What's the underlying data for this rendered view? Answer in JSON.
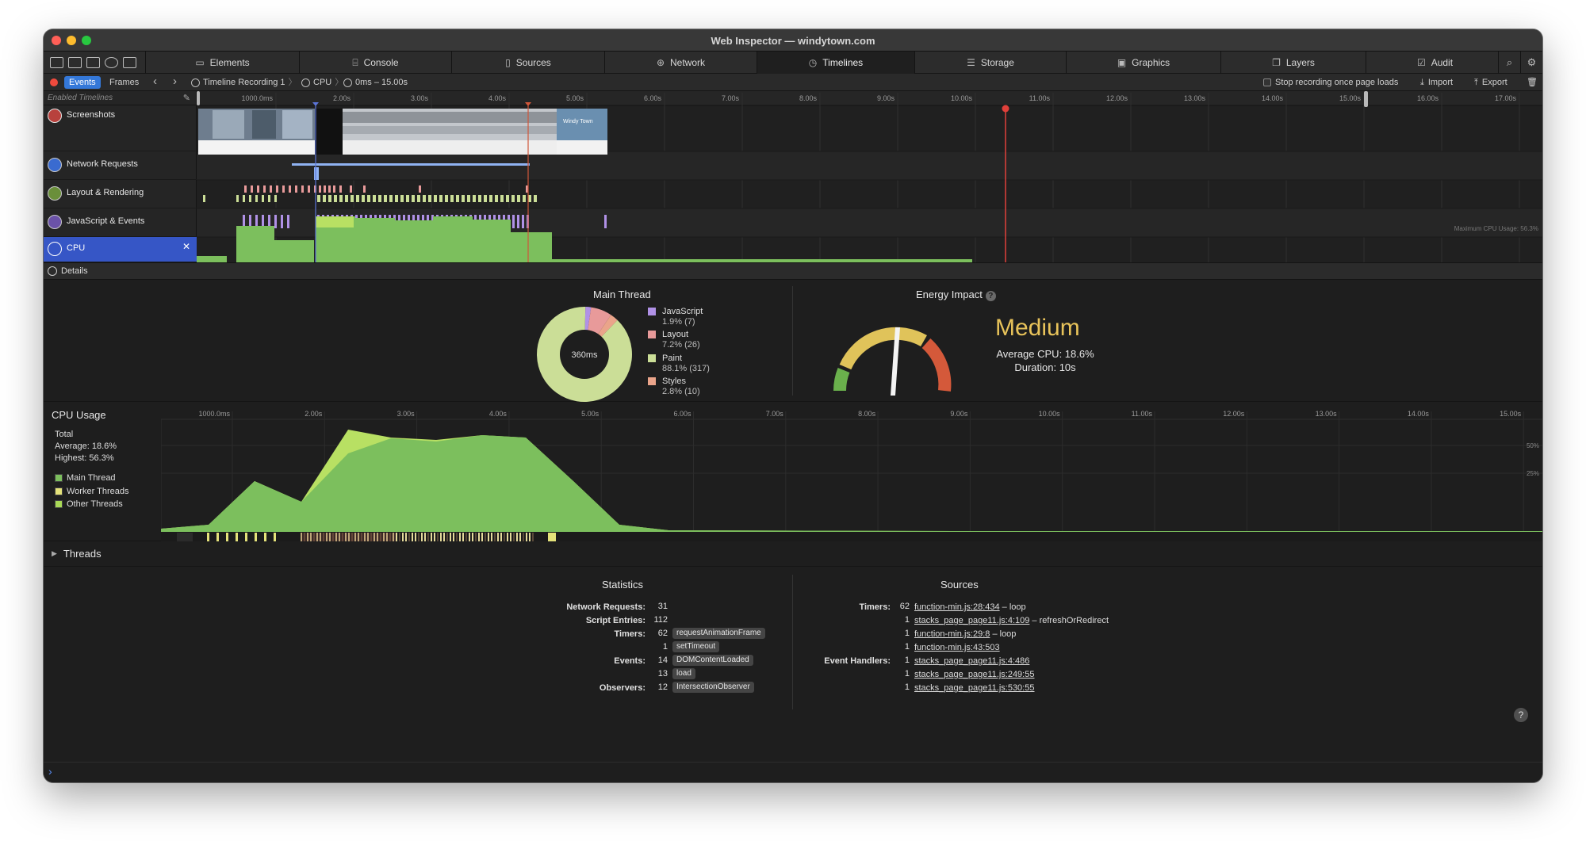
{
  "window": {
    "title": "Web Inspector — windytown.com"
  },
  "tabs": [
    {
      "label": "Elements",
      "icon": "elements-icon"
    },
    {
      "label": "Console",
      "icon": "console-icon"
    },
    {
      "label": "Sources",
      "icon": "sources-icon"
    },
    {
      "label": "Network",
      "icon": "network-icon"
    },
    {
      "label": "Timelines",
      "icon": "timelines-icon"
    },
    {
      "label": "Storage",
      "icon": "storage-icon"
    },
    {
      "label": "Graphics",
      "icon": "graphics-icon"
    },
    {
      "label": "Layers",
      "icon": "layers-icon"
    },
    {
      "label": "Audit",
      "icon": "audit-icon"
    }
  ],
  "toolbar": {
    "events_label": "Events",
    "frames_label": "Frames",
    "recording_name": "Timeline Recording 1",
    "crumb_cpu": "CPU",
    "time_range": "0ms – 15.00s",
    "stop_recording_label": "Stop recording once page loads",
    "import_label": "Import",
    "export_label": "Export"
  },
  "overview": {
    "header": "Enabled Timelines",
    "rows": [
      {
        "label": "Screenshots",
        "icon": "camera-icon"
      },
      {
        "label": "Network Requests",
        "icon": "network-arrows-icon"
      },
      {
        "label": "Layout & Rendering",
        "icon": "brush-icon"
      },
      {
        "label": "JavaScript & Events",
        "icon": "javascript-icon"
      },
      {
        "label": "CPU",
        "icon": "cpu-icon"
      }
    ],
    "ruler_ticks": [
      "1000.0ms",
      "2.00s",
      "3.00s",
      "4.00s",
      "5.00s",
      "6.00s",
      "7.00s",
      "8.00s",
      "9.00s",
      "10.00s",
      "11.00s",
      "12.00s",
      "13.00s",
      "14.00s",
      "15.00s",
      "16.00s",
      "17.00s"
    ],
    "max_cpu_label": "Maximum CPU Usage: 56.3%",
    "screenshot_caption": "Windy Town"
  },
  "details_label": "Details",
  "main_thread": {
    "title": "Main Thread",
    "total": "360ms",
    "legend": [
      {
        "name": "JavaScript",
        "value": "1.9% (7)",
        "color": "#b091e6",
        "pct": 1.9
      },
      {
        "name": "Layout",
        "value": "7.2% (26)",
        "color": "#e89a9a",
        "pct": 7.2
      },
      {
        "name": "Paint",
        "value": "88.1% (317)",
        "color": "#cbde97",
        "pct": 88.1
      },
      {
        "name": "Styles",
        "value": "2.8% (10)",
        "color": "#eaa48a",
        "pct": 2.8
      }
    ]
  },
  "energy": {
    "title": "Energy Impact",
    "level": "Medium",
    "average": "Average CPU: 18.6%",
    "duration": "Duration: 10s",
    "needle_fraction": 0.5
  },
  "cpu_usage": {
    "title": "CPU Usage",
    "total_label": "Total",
    "average": "Average: 18.6%",
    "highest": "Highest: 56.3%",
    "legend": [
      {
        "name": "Main Thread",
        "color": "#7cbf5d"
      },
      {
        "name": "Worker Threads",
        "color": "#e4e27a"
      },
      {
        "name": "Other Threads",
        "color": "#a9d957"
      }
    ],
    "ruler_ticks": [
      "1000.0ms",
      "2.00s",
      "3.00s",
      "4.00s",
      "5.00s",
      "6.00s",
      "7.00s",
      "8.00s",
      "9.00s",
      "10.00s",
      "11.00s",
      "12.00s",
      "13.00s",
      "14.00s",
      "15.00s"
    ],
    "y_label_50": "50%",
    "y_label_25": "25%"
  },
  "threads_label": "Threads",
  "statistics": {
    "title": "Statistics",
    "rows": [
      {
        "key": "Network Requests:",
        "count": "31",
        "pill": ""
      },
      {
        "key": "Script Entries:",
        "count": "112",
        "pill": ""
      },
      {
        "key": "Timers:",
        "count": "62",
        "pill": "requestAnimationFrame"
      },
      {
        "key": "",
        "count": "1",
        "pill": "setTimeout"
      },
      {
        "key": "Events:",
        "count": "14",
        "pill": "DOMContentLoaded"
      },
      {
        "key": "",
        "count": "13",
        "pill": "load"
      },
      {
        "key": "Observers:",
        "count": "12",
        "pill": "IntersectionObserver"
      }
    ]
  },
  "sources": {
    "title": "Sources",
    "rows": [
      {
        "key": "Timers:",
        "count": "62",
        "link": "function-min.js:28:434",
        "extra": " – loop"
      },
      {
        "key": "",
        "count": "1",
        "link": "stacks_page_page11.js:4:109",
        "extra": " – refreshOrRedirect"
      },
      {
        "key": "",
        "count": "1",
        "link": "function-min.js:29:8",
        "extra": " – loop"
      },
      {
        "key": "",
        "count": "1",
        "link": "function-min.js:43:503",
        "extra": ""
      },
      {
        "key": "Event Handlers:",
        "count": "1",
        "link": "stacks_page_page11.js:4:486",
        "extra": ""
      },
      {
        "key": "",
        "count": "1",
        "link": "stacks_page_page11.js:249:55",
        "extra": ""
      },
      {
        "key": "",
        "count": "1",
        "link": "stacks_page_page11.js:530:55",
        "extra": ""
      }
    ]
  },
  "console_prompt": "›",
  "help_label": "?"
}
